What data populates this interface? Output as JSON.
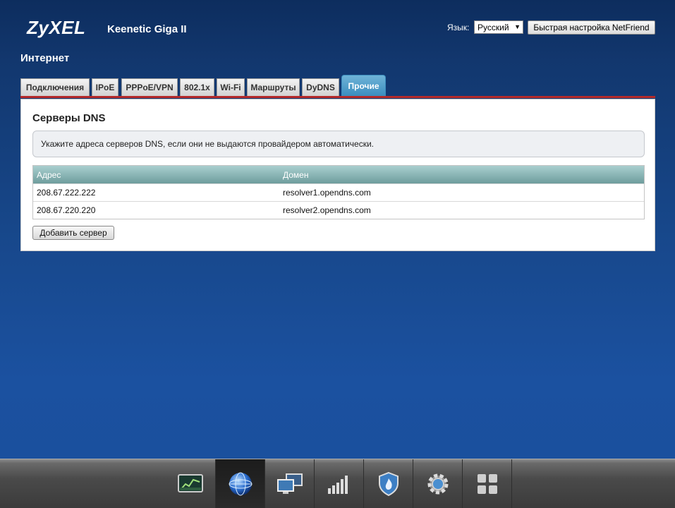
{
  "header": {
    "logo": "ZyXEL",
    "model": "Keenetic Giga II",
    "lang_label": "Язык:",
    "lang_value": "Русский",
    "quick_setup": "Быстрая настройка NetFriend"
  },
  "page_title": "Интернет",
  "tabs": [
    {
      "label": "Подключения",
      "active": false
    },
    {
      "label": "IPoE",
      "active": false
    },
    {
      "label": "PPPoE/VPN",
      "active": false
    },
    {
      "label": "802.1x",
      "active": false
    },
    {
      "label": "Wi-Fi",
      "active": false
    },
    {
      "label": "Маршруты",
      "active": false
    },
    {
      "label": "DyDNS",
      "active": false
    },
    {
      "label": "Прочие",
      "active": true
    }
  ],
  "section": {
    "title": "Серверы DNS",
    "hint": "Укажите адреса серверов DNS, если они не выдаются провайдером автоматически.",
    "columns": [
      "Адрес",
      "Домен"
    ],
    "rows": [
      [
        "208.67.222.222",
        "resolver1.opendns.com"
      ],
      [
        "208.67.220.220",
        "resolver2.opendns.com"
      ]
    ],
    "add_button": "Добавить сервер"
  },
  "dock": [
    "monitor-icon",
    "internet-globe-icon",
    "home-network-icon",
    "wifi-signal-icon",
    "security-shield-icon",
    "settings-gear-icon",
    "apps-icon"
  ],
  "colors": {
    "accent_tab": "#3b8dbe",
    "tab_line": "#b52a2a",
    "table_header": "#7fabab"
  }
}
